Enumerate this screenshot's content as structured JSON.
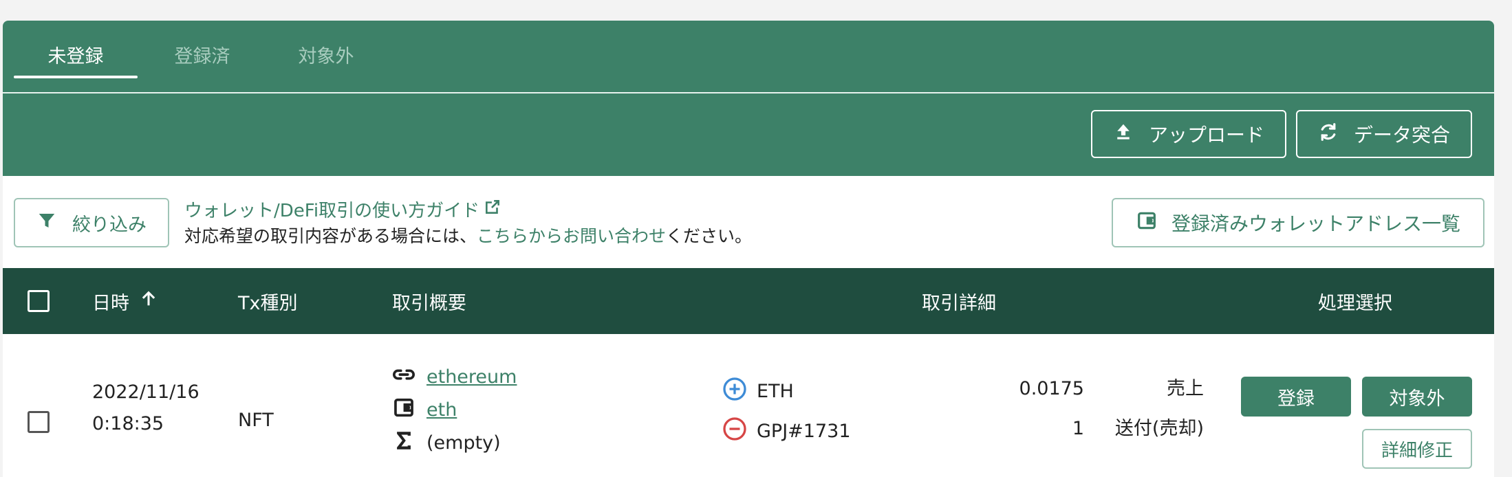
{
  "tabs": [
    {
      "label": "未登録",
      "active": true
    },
    {
      "label": "登録済",
      "active": false
    },
    {
      "label": "対象外",
      "active": false
    }
  ],
  "toolbar": {
    "upload_label": "アップロード",
    "reconcile_label": "データ突合"
  },
  "filter": {
    "label": "絞り込み"
  },
  "guide": {
    "link_text": "ウォレット/DeFi取引の使い方ガイド",
    "contact_prefix": "対応希望の取引内容がある場合には、",
    "contact_link": "こちらからお問い合わせ",
    "contact_suffix": "ください。"
  },
  "wallet_list_button": "登録済みウォレットアドレス一覧",
  "table": {
    "headers": {
      "datetime": "日時",
      "tx_type": "Tx種別",
      "summary": "取引概要",
      "detail": "取引詳細",
      "action": "処理選択"
    },
    "rows": [
      {
        "date": "2022/11/16",
        "time": "0:18:35",
        "tx_type": "NFT",
        "chain": "ethereum",
        "wallet": "eth",
        "sum": "(empty)",
        "details": [
          {
            "direction": "in",
            "asset": "ETH",
            "amount": "0.0175",
            "label": "売上"
          },
          {
            "direction": "out",
            "asset": "GPJ#1731",
            "amount": "1",
            "label": "送付(売却)"
          }
        ],
        "register_label": "登録",
        "exclude_label": "対象外",
        "edit_label": "詳細修正"
      }
    ]
  },
  "colors": {
    "primary": "#3d8168",
    "header_dark": "#1f4d3f",
    "in_icon": "#3d8bd6",
    "out_icon": "#d64545"
  }
}
